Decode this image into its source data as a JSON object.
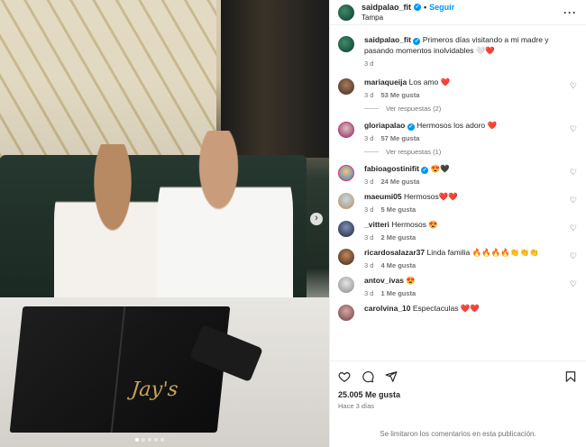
{
  "post": {
    "username": "saidpalao_fit",
    "follow_label": "Seguir",
    "location": "Tampa",
    "more_icon": "more-horizontal-icon",
    "image_brand_text": "Jay's",
    "caption": {
      "username": "saidpalao_fit",
      "text": "Primeros días visitando a mi madre y pasando momentos inolvidables 🤍❤️",
      "time": "3 d"
    }
  },
  "comments": [
    {
      "user": "mariaqueija",
      "text": "Los amo ❤️",
      "time": "3 d",
      "likes": "53 Me gusta",
      "replies": "Ver respuestas (2)"
    },
    {
      "user": "gloriapalao",
      "text": "Hermosos los adoro ❤️",
      "time": "3 d",
      "likes": "57 Me gusta",
      "replies": "Ver respuestas (1)"
    },
    {
      "user": "fabioagostinifit",
      "text": "😍🖤",
      "time": "3 d",
      "likes": "24 Me gusta",
      "replies": ""
    },
    {
      "user": "maeumi05",
      "text": "Hermosos❤️❤️",
      "time": "3 d",
      "likes": "5 Me gusta",
      "replies": ""
    },
    {
      "user": "_vitteri",
      "text": "Hermosos 😍",
      "time": "3 d",
      "likes": "2 Me gusta",
      "replies": ""
    },
    {
      "user": "ricardosalazar37",
      "text": "Linda familia 🔥🔥🔥🔥👏👏👏",
      "time": "3 d",
      "likes": "4 Me gusta",
      "replies": ""
    },
    {
      "user": "antov_ivas",
      "text": "😍",
      "time": "3 d",
      "likes": "1 Me gusta",
      "replies": ""
    },
    {
      "user": "carolvina_10",
      "text": "Espectaculas ❤️❤️",
      "time": "",
      "likes": "",
      "replies": ""
    }
  ],
  "footer": {
    "likes_count": "25.005 Me gusta",
    "posted_ago": "Hace 3 días",
    "limited_text": "Se limitaron los comentarios en esta publicación."
  },
  "icons": [
    "heart-icon",
    "comment-icon",
    "share-icon",
    "bookmark-icon",
    "verified-icon",
    "chevron-right-icon"
  ]
}
